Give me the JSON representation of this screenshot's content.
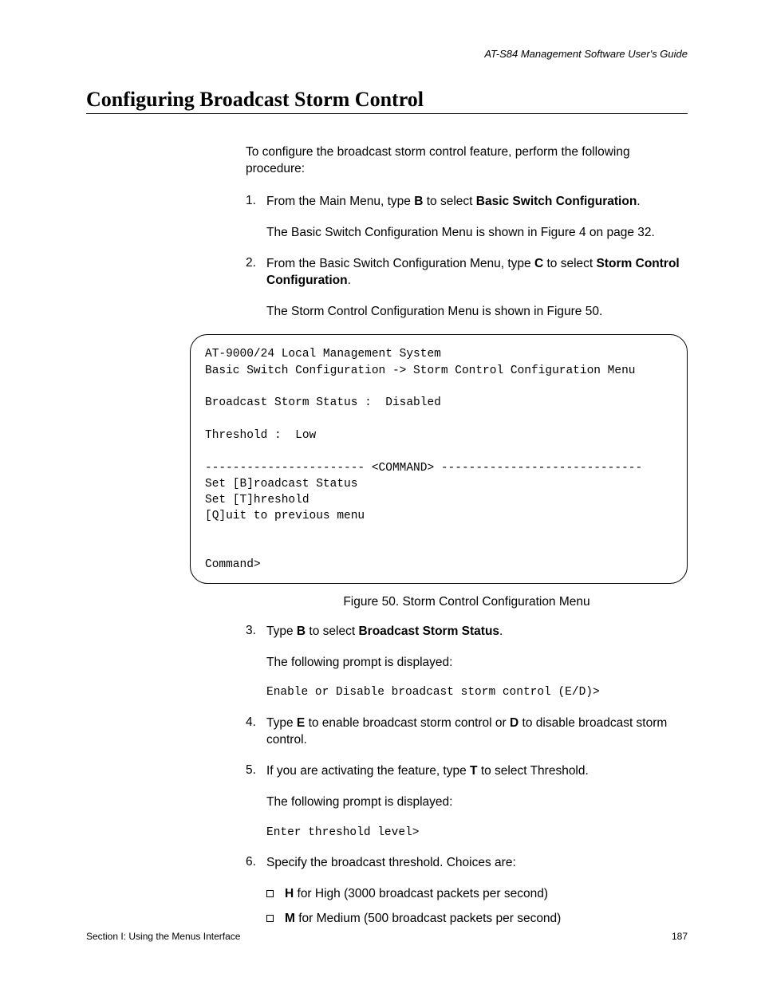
{
  "header": {
    "guide": "AT-S84 Management Software User's Guide"
  },
  "title": "Configuring Broadcast Storm Control",
  "intro": "To configure the broadcast storm control feature, perform the following procedure:",
  "step1": {
    "num": "1.",
    "pre": "From the Main Menu, type ",
    "key": "B",
    "mid": " to select ",
    "bold": "Basic Switch Configuration",
    "post": ".",
    "sub": "The Basic Switch Configuration Menu is shown in Figure 4 on page 32."
  },
  "step2": {
    "num": "2.",
    "pre": "From the Basic Switch Configuration Menu, type ",
    "key": "C",
    "mid": " to select ",
    "bold": "Storm Control Configuration",
    "post": ".",
    "sub": "The Storm Control Configuration Menu is shown in Figure 50."
  },
  "terminal": {
    "l1": "AT-9000/24 Local Management System",
    "l2": "Basic Switch Configuration -> Storm Control Configuration Menu",
    "l3": "",
    "l4": "Broadcast Storm Status :  Disabled",
    "l5": "",
    "l6": "Threshold :  Low",
    "l7": "",
    "l8": "----------------------- <COMMAND> -----------------------------",
    "l9": "Set [B]roadcast Status",
    "l10": "Set [T]hreshold",
    "l11": "[Q]uit to previous menu",
    "l12": "",
    "l13": "",
    "l14": "Command>"
  },
  "figcap": "Figure 50. Storm Control Configuration Menu",
  "step3": {
    "num": "3.",
    "pre": "Type ",
    "key": "B",
    "mid": " to select ",
    "bold": "Broadcast Storm Status",
    "post": ".",
    "sub": "The following prompt is displayed:",
    "mono": "Enable or Disable broadcast storm control (E/D)>"
  },
  "step4": {
    "num": "4.",
    "pre": "Type ",
    "key1": "E",
    "mid1": " to enable broadcast storm control or ",
    "key2": "D",
    "post": " to disable broadcast storm control."
  },
  "step5": {
    "num": "5.",
    "pre": "If you are activating the feature, type ",
    "key": "T",
    "post": " to select Threshold.",
    "sub": "The following prompt is displayed:",
    "mono": "Enter threshold level>"
  },
  "step6": {
    "num": "6.",
    "text": "Specify the broadcast threshold. Choices are:",
    "b1": {
      "key": "H",
      "text": " for High (3000 broadcast packets per second)"
    },
    "b2": {
      "key": "M",
      "text": " for Medium (500 broadcast packets per second)"
    }
  },
  "footer": {
    "left": "Section I: Using the Menus Interface",
    "right": "187"
  }
}
